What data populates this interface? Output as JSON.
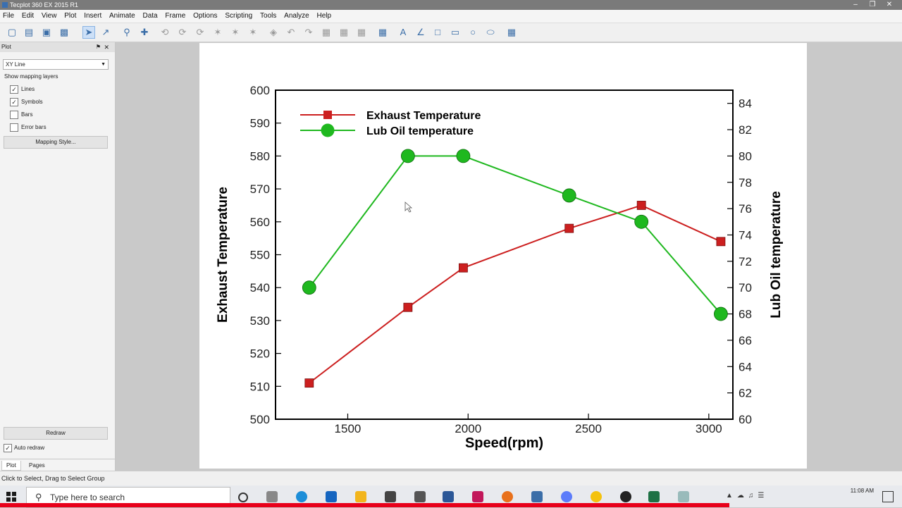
{
  "window": {
    "title": "Tecplot 360 EX 2015 R1"
  },
  "menu": [
    "File",
    "Edit",
    "View",
    "Plot",
    "Insert",
    "Animate",
    "Data",
    "Frame",
    "Options",
    "Scripting",
    "Tools",
    "Analyze",
    "Help"
  ],
  "sidebar": {
    "panel_title": "Plot",
    "plot_type": "XY Line",
    "mapping_label": "Show mapping layers",
    "layers": [
      {
        "label": "Lines",
        "checked": true
      },
      {
        "label": "Symbols",
        "checked": true
      },
      {
        "label": "Bars",
        "checked": false
      },
      {
        "label": "Error bars",
        "checked": false
      }
    ],
    "mapping_style_label": "Mapping Style...",
    "redraw_label": "Redraw",
    "auto_redraw_label": "Auto redraw",
    "tabs": [
      "Plot",
      "Pages"
    ]
  },
  "status": {
    "text": "Click to Select, Drag to Select Group"
  },
  "taskbar": {
    "search_placeholder": "Type here to search",
    "time": "11:08 AM"
  },
  "chart_data": {
    "type": "line",
    "xlabel": "Speed(rpm)",
    "ylabel": "Exhaust Temperature",
    "y2label": "Lub Oil temperature",
    "xlim": [
      1200,
      3100
    ],
    "ylim": [
      500,
      600
    ],
    "y2lim": [
      60,
      85
    ],
    "xticks": [
      1500,
      2000,
      2500,
      3000
    ],
    "yticks": [
      500,
      510,
      520,
      530,
      540,
      550,
      560,
      570,
      580,
      590,
      600
    ],
    "y2ticks": [
      60,
      62,
      64,
      66,
      68,
      70,
      72,
      74,
      76,
      78,
      80,
      82,
      84
    ],
    "legend": "top-left",
    "grid": false,
    "series": [
      {
        "name": "Exhaust Temperature",
        "axis": "left",
        "color": "#cc1f1f",
        "marker": "square",
        "x": [
          1340,
          1750,
          1980,
          2420,
          2720,
          3050
        ],
        "y": [
          511,
          534,
          546,
          558,
          565,
          554
        ]
      },
      {
        "name": "Lub Oil temperature",
        "axis": "right",
        "color": "#1fb81f",
        "marker": "circle",
        "x": [
          1340,
          1750,
          1980,
          2420,
          2720,
          3050
        ],
        "y": [
          70,
          80,
          80,
          77,
          75,
          68
        ]
      }
    ]
  }
}
